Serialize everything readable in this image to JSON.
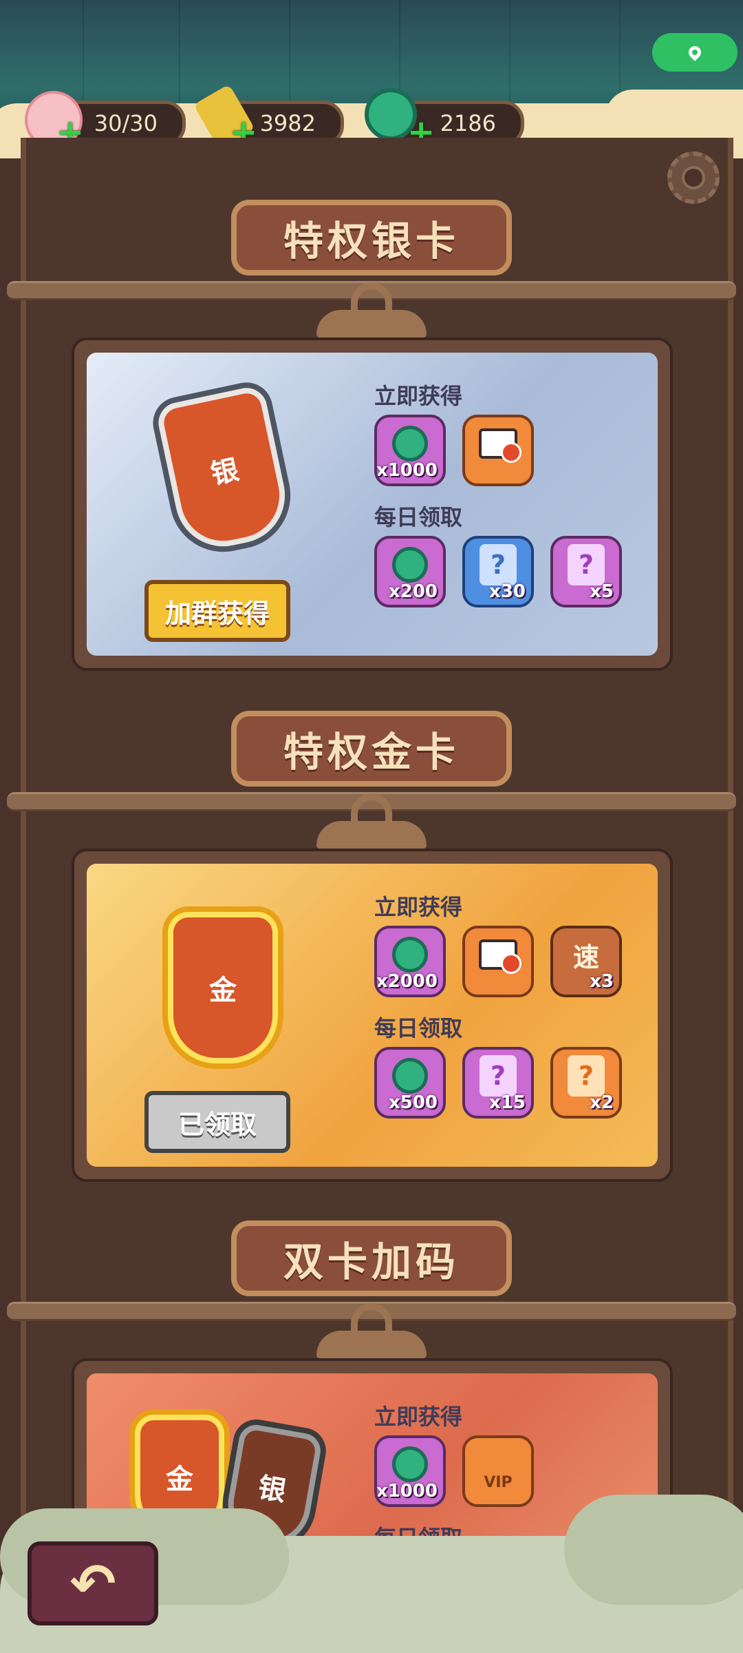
{
  "topbar": {
    "resources": [
      {
        "name": "peach",
        "value": "30/30",
        "icon": "peach-icon"
      },
      {
        "name": "jade-sword",
        "value": "3982",
        "icon": "sword-icon"
      },
      {
        "name": "jade",
        "value": "2186",
        "icon": "jade-icon"
      }
    ],
    "map_icon": "location-pin-icon",
    "settings_icon": "gear-icon"
  },
  "sections": [
    {
      "title": "特权银卡",
      "badge_char": "银",
      "immediate_label": "立即获得",
      "daily_label": "每日领取",
      "immediate_items": [
        {
          "icon": "jade-icon",
          "qty": "x1000"
        },
        {
          "icon": "ad-free-tv-icon",
          "qty": ""
        }
      ],
      "daily_items": [
        {
          "icon": "jade-icon",
          "qty": "x200"
        },
        {
          "icon": "blue-puzzle-icon",
          "qty": "x30"
        },
        {
          "icon": "purple-puzzle-icon",
          "qty": "x5"
        }
      ],
      "button": "加群获得"
    },
    {
      "title": "特权金卡",
      "badge_char": "金",
      "immediate_label": "立即获得",
      "daily_label": "每日领取",
      "immediate_items": [
        {
          "icon": "jade-icon",
          "qty": "x2000"
        },
        {
          "icon": "ad-free-tv-icon",
          "qty": ""
        },
        {
          "icon": "speed-icon",
          "qty": "x3",
          "glyph": "速"
        }
      ],
      "daily_items": [
        {
          "icon": "jade-icon",
          "qty": "x500"
        },
        {
          "icon": "purple-puzzle-icon",
          "qty": "x15"
        },
        {
          "icon": "orange-puzzle-icon",
          "qty": "x2"
        }
      ],
      "button": "已领取"
    },
    {
      "title": "双卡加码",
      "badge_char_gold": "金",
      "badge_char_silver": "银",
      "immediate_label": "立即获得",
      "daily_label": "每日领取",
      "immediate_items": [
        {
          "icon": "jade-icon",
          "qty": "x1000"
        },
        {
          "icon": "vip-frame-icon",
          "qty": "",
          "glyph": "VIP"
        }
      ]
    }
  ],
  "colors": {
    "accent": "#f4c233",
    "board": "#4d362c",
    "title_plate": "#8a4f3a"
  }
}
